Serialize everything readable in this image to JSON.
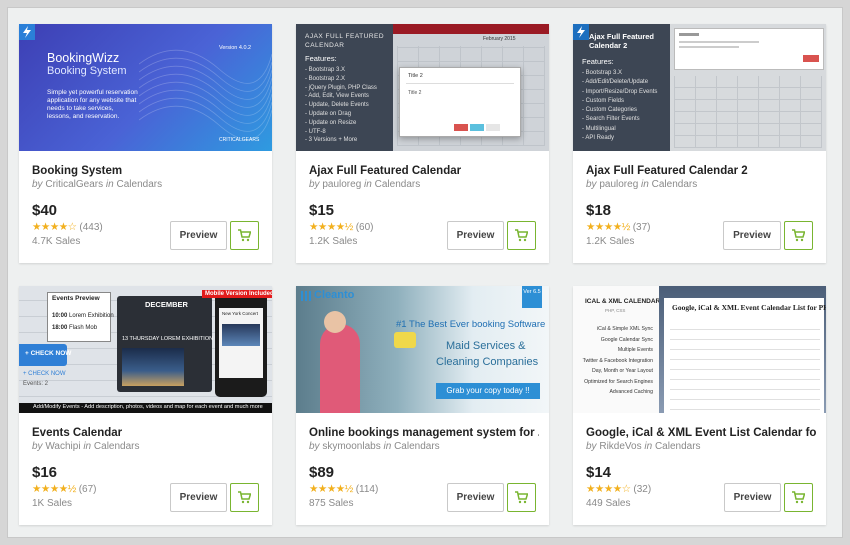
{
  "colors": {
    "accent_green": "#79b530",
    "star": "#f2b01e"
  },
  "products": [
    {
      "title": "Booking System",
      "author": "CriticalGears",
      "category": "Calendars",
      "price": "$40",
      "stars_text": "★★★★☆",
      "rating_count": "(443)",
      "sales": "4.7K Sales",
      "preview_label": "Preview",
      "cart_icon": "cart-icon",
      "thumb": {
        "brand": "BookingWizz",
        "subtitle": "Booking System",
        "version": "Version 4.0.2",
        "desc": "Simple yet powerful reservation application for any website that needs to take services, lessons, and reservation.",
        "logo": "CRITICALGEARS"
      }
    },
    {
      "title": "Ajax Full Featured Calendar",
      "author": "pauloreg",
      "category": "Calendars",
      "price": "$15",
      "stars_text": "★★★★½",
      "rating_count": "(60)",
      "sales": "1.2K Sales",
      "preview_label": "Preview",
      "cart_icon": "cart-icon",
      "thumb": {
        "heading": "AJAX FULL FEATURED CALENDAR",
        "features_label": "Features:",
        "features": [
          "- Bootstrap 3.X",
          "- Bootstrap 2.X",
          "- jQuery Plugin, PHP Class",
          "- Add, Edit, View Events",
          "- Update, Delete Events",
          "- Update on Drag",
          "- Update on Resize",
          "- UTF-8",
          "- 3 Versions + More"
        ],
        "modal_title": "Title 2",
        "month": "February 2015"
      }
    },
    {
      "title": "Ajax Full Featured Calendar 2",
      "author": "pauloreg",
      "category": "Calendars",
      "price": "$18",
      "stars_text": "★★★★½",
      "rating_count": "(37)",
      "sales": "1.2K Sales",
      "preview_label": "Preview",
      "cart_icon": "cart-icon",
      "thumb": {
        "heading": "Ajax Full Featured Calendar 2",
        "features_label": "Features:",
        "features": [
          "- Bootstrap 3.X",
          "- Add/Edit/Delete/Update",
          "- Import/Resize/Drop Events",
          "- Custom Fields",
          "- Custom Categories",
          "- Search Filter Events",
          "- Multilingual",
          "- API Ready"
        ]
      }
    },
    {
      "title": "Events Calendar",
      "author": "Wachipi",
      "category": "Calendars",
      "price": "$16",
      "stars_text": "★★★★½",
      "rating_count": "(67)",
      "sales": "1K Sales",
      "preview_label": "Preview",
      "cart_icon": "cart-icon",
      "thumb": {
        "preview_label": "Events Preview",
        "time1": "10:00",
        "event1": "Lorem Exhibition",
        "time2": "18:00",
        "event2": "Flash Mob",
        "month": "DECEMBER",
        "day_line": "13 THURSDAY  LOREM EXHIBITION",
        "mobile_badge": "Mobile Version Included",
        "city": "New York Concert",
        "check_now": "+ CHECK NOW",
        "events": "Events: 2",
        "banner": "Add/Modify Events - Add description, photos, videos and map for each event and much more"
      }
    },
    {
      "title": "Online bookings management system for ...",
      "author": "skymoonlabs",
      "category": "Calendars",
      "price": "$89",
      "stars_text": "★★★★½",
      "rating_count": "(114)",
      "sales": "875 Sales",
      "preview_label": "Preview",
      "cart_icon": "cart-icon",
      "thumb": {
        "brand": "Cleanto",
        "version": "Ver 6.5",
        "tagline": "#1 The Best Ever booking Software",
        "line1": "Maid Services &",
        "line2": "Cleaning Companies",
        "cta": "Grab your copy today !!"
      }
    },
    {
      "title": "Google, iCal & XML Event List Calendar for ...",
      "author": "RikdeVos",
      "category": "Calendars",
      "price": "$14",
      "stars_text": "★★★★☆",
      "rating_count": "(32)",
      "sales": "449 Sales",
      "preview_label": "Preview",
      "cart_icon": "cart-icon",
      "thumb": {
        "heading": "ICAL & XML CALENDAR",
        "sub": "PHP, CSS",
        "page_title": "Google, iCal & XML Event Calendar List for PHP",
        "features": [
          "iCal & Simple XML Sync",
          "Google Calendar Sync",
          "Multiple Events",
          "Twitter & Facebook Integration",
          "Day, Month or Year Layout",
          "Optimized for Search Engines",
          "Advanced Caching"
        ]
      }
    }
  ]
}
